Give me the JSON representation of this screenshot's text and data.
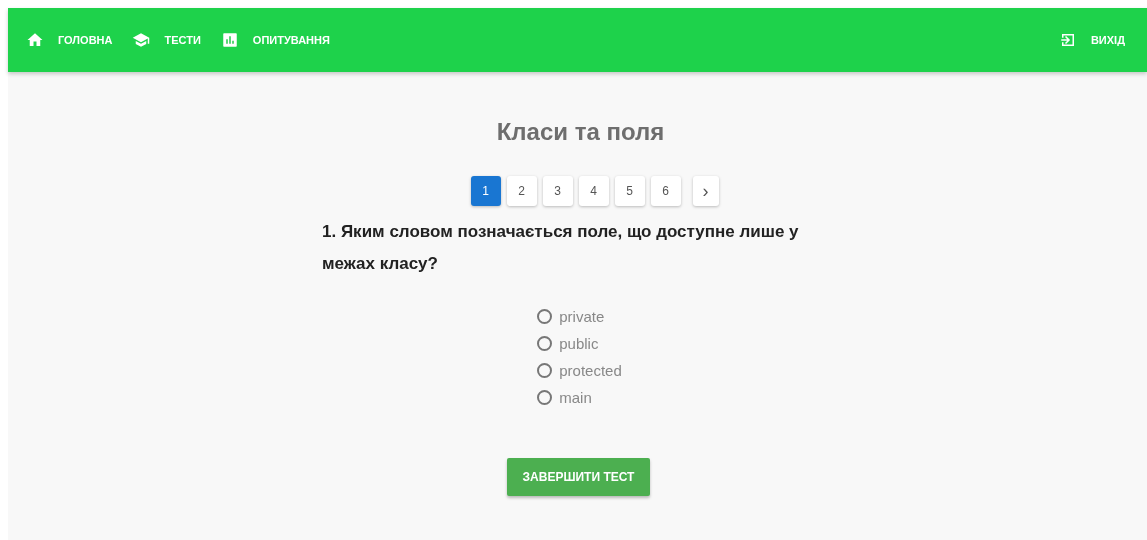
{
  "nav": {
    "items": [
      {
        "label": "ГОЛОВНА",
        "kind": "home"
      },
      {
        "label": "ТЕСТИ",
        "kind": "school"
      },
      {
        "label": "ОПИТУВАННЯ",
        "kind": "chart"
      }
    ],
    "logout": {
      "label": "ВИХІД"
    }
  },
  "title": "Класи та поля",
  "pagination": {
    "pages": [
      {
        "label": "1",
        "selected": true
      },
      {
        "label": "2",
        "selected": false
      },
      {
        "label": "3",
        "selected": false
      },
      {
        "label": "4",
        "selected": false
      },
      {
        "label": "5",
        "selected": false
      },
      {
        "label": "6",
        "selected": false
      }
    ],
    "next": "›"
  },
  "question": "1. Яким словом позначається поле, що доступне лише у межах класу?",
  "options": [
    {
      "label": "private",
      "selected": false
    },
    {
      "label": "public",
      "selected": false
    },
    {
      "label": "protected",
      "selected": false
    },
    {
      "label": "main",
      "selected": false
    }
  ],
  "submit": "ЗАВЕРШИТИ ТЕСТ"
}
